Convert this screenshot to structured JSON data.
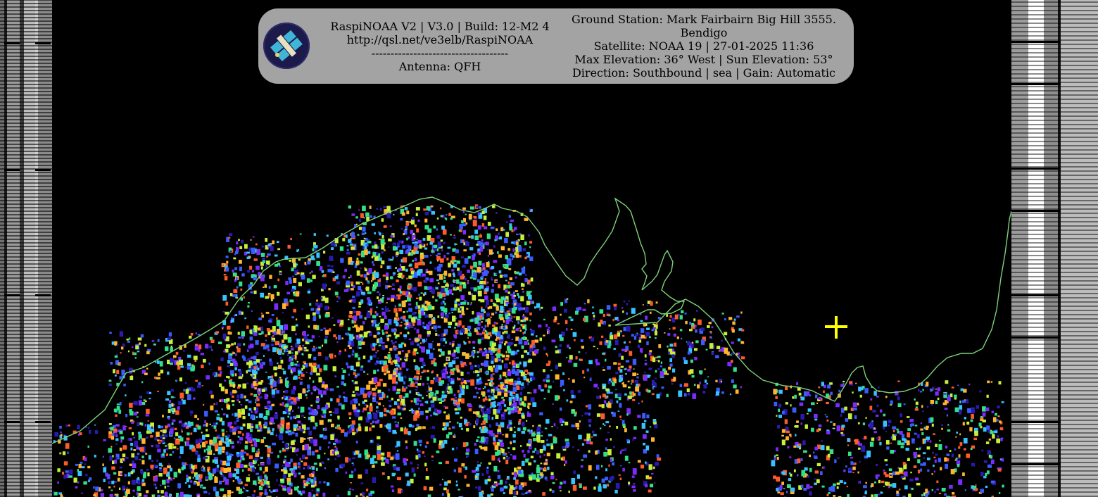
{
  "banner": {
    "left_lines": [
      "RaspiNOAA V2 | V3.0 | Build: 12-M2 4",
      "http://qsl.net/ve3elb/RaspiNOAA",
      "------------------------------------",
      "Antenna: QFH"
    ],
    "right_lines": [
      "Ground Station: Mark Fairbairn Big Hill 3555.",
      "Bendigo",
      "Satellite: NOAA 19 | 27-01-2025 11:36",
      "Max Elevation: 36° West | Sun Elevation: 53°",
      "Direction: Southbound | sea | Gain: Automatic"
    ],
    "logo_icon": "satellite-logo-icon"
  },
  "image": {
    "colors": {
      "background": "#000000",
      "coastline": "#7ed27a",
      "crosshair": "#ffff00",
      "banner_bg": "#a3a3a3",
      "palette": [
        "#2a1bb0",
        "#3a5cff",
        "#36c3ff",
        "#33e08a",
        "#c8f03a",
        "#ffb52e",
        "#ff5a2a",
        "#7a2cff"
      ]
    }
  }
}
